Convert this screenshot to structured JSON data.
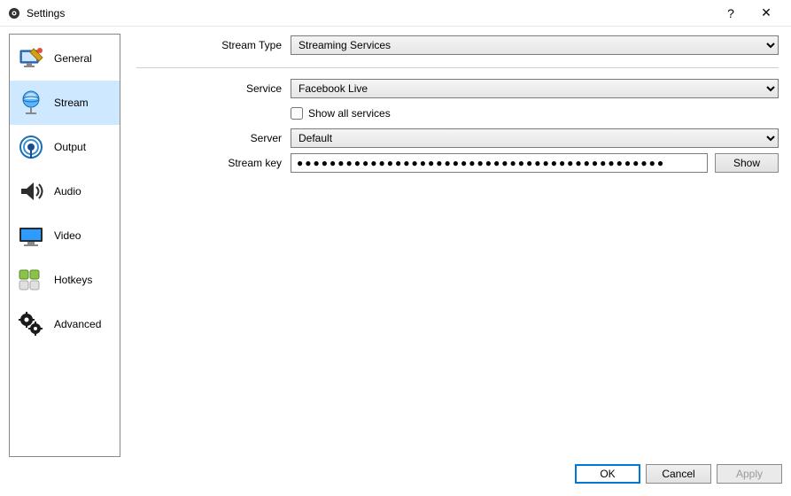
{
  "window": {
    "title": "Settings",
    "help": "?",
    "close": "✕"
  },
  "sidebar": {
    "items": [
      {
        "label": "General"
      },
      {
        "label": "Stream"
      },
      {
        "label": "Output"
      },
      {
        "label": "Audio"
      },
      {
        "label": "Video"
      },
      {
        "label": "Hotkeys"
      },
      {
        "label": "Advanced"
      }
    ],
    "selected": 1
  },
  "form": {
    "stream_type_label": "Stream Type",
    "stream_type_value": "Streaming Services",
    "service_label": "Service",
    "service_value": "Facebook Live",
    "show_all_label": "Show all services",
    "show_all_checked": false,
    "server_label": "Server",
    "server_value": "Default",
    "stream_key_label": "Stream key",
    "stream_key_value": "●●●●●●●●●●●●●●●●●●●●●●●●●●●●●●●●●●●●●●●●●●●●●",
    "show_button": "Show"
  },
  "footer": {
    "ok": "OK",
    "cancel": "Cancel",
    "apply": "Apply"
  }
}
